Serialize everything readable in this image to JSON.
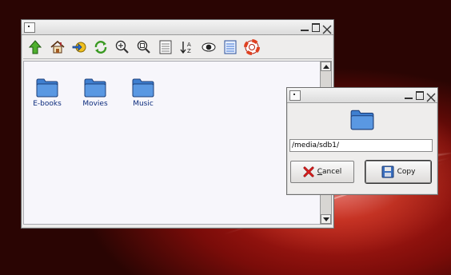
{
  "colors": {
    "desktop": "#8a0f0b",
    "folder": "#3f7fd0",
    "label": "#0a2a7c"
  },
  "file_manager": {
    "toolbar_icons": [
      "up-arrow-icon",
      "home-icon",
      "go-to-icon",
      "refresh-icon",
      "zoom-in-icon",
      "zoom-fit-icon",
      "details-view-icon",
      "sort-icon",
      "show-hidden-icon",
      "list-view-icon",
      "help-icon"
    ],
    "items": [
      {
        "label": "E-books",
        "icon": "folder-icon"
      },
      {
        "label": "Movies",
        "icon": "folder-icon"
      },
      {
        "label": "Music",
        "icon": "folder-icon"
      }
    ]
  },
  "copy_dialog": {
    "path_value": "/media/sdb1/",
    "cancel_prefix": "",
    "cancel_mnemonic": "C",
    "cancel_rest": "ancel",
    "copy_label": "Copy"
  }
}
